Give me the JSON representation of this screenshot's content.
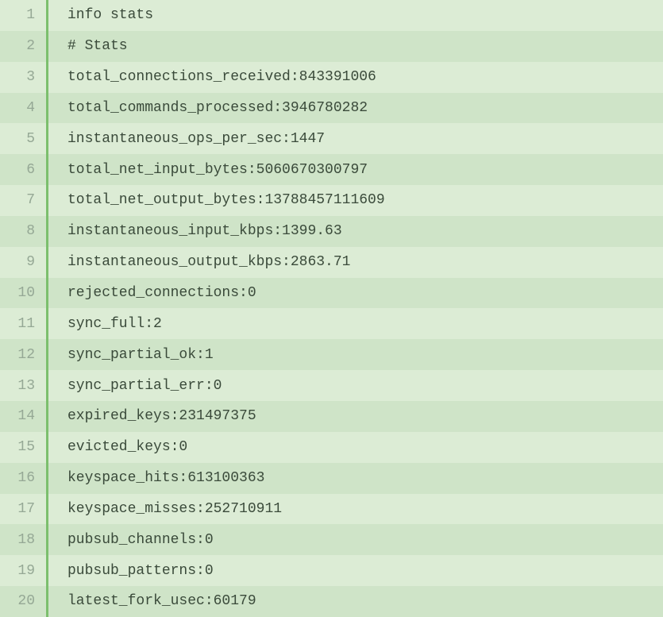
{
  "lines": [
    {
      "num": "1",
      "text": "info stats"
    },
    {
      "num": "2",
      "text": "# Stats"
    },
    {
      "num": "3",
      "text": "total_connections_received:843391006"
    },
    {
      "num": "4",
      "text": "total_commands_processed:3946780282"
    },
    {
      "num": "5",
      "text": "instantaneous_ops_per_sec:1447"
    },
    {
      "num": "6",
      "text": "total_net_input_bytes:5060670300797"
    },
    {
      "num": "7",
      "text": "total_net_output_bytes:13788457111609"
    },
    {
      "num": "8",
      "text": "instantaneous_input_kbps:1399.63"
    },
    {
      "num": "9",
      "text": "instantaneous_output_kbps:2863.71"
    },
    {
      "num": "10",
      "text": "rejected_connections:0"
    },
    {
      "num": "11",
      "text": "sync_full:2"
    },
    {
      "num": "12",
      "text": "sync_partial_ok:1"
    },
    {
      "num": "13",
      "text": "sync_partial_err:0"
    },
    {
      "num": "14",
      "text": "expired_keys:231497375"
    },
    {
      "num": "15",
      "text": "evicted_keys:0"
    },
    {
      "num": "16",
      "text": "keyspace_hits:613100363"
    },
    {
      "num": "17",
      "text": "keyspace_misses:252710911"
    },
    {
      "num": "18",
      "text": "pubsub_channels:0"
    },
    {
      "num": "19",
      "text": "pubsub_patterns:0"
    },
    {
      "num": "20",
      "text": "latest_fork_usec:60179"
    }
  ]
}
